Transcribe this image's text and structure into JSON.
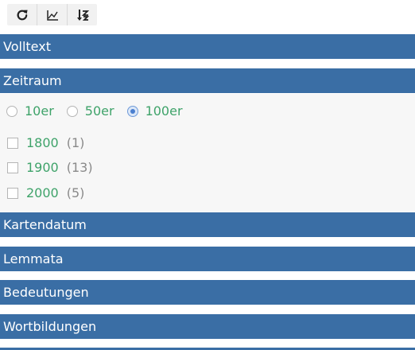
{
  "toolbar": {
    "buttons": [
      {
        "icon": "refresh-icon"
      },
      {
        "icon": "chart-icon"
      },
      {
        "icon": "sort-icon"
      }
    ]
  },
  "sections": {
    "volltext": "Volltext",
    "zeitraum": "Zeitraum",
    "kartendatum": "Kartendatum",
    "lemmata": "Lemmata",
    "bedeutungen": "Bedeutungen",
    "wortbildungen": "Wortbildungen"
  },
  "zeitraum": {
    "interval_options": [
      {
        "label": "10er",
        "checked": false
      },
      {
        "label": "50er",
        "checked": false
      },
      {
        "label": "100er",
        "checked": true
      }
    ],
    "items": [
      {
        "label": "1800",
        "count": "(1)"
      },
      {
        "label": "1900",
        "count": "(13)"
      },
      {
        "label": "2000",
        "count": "(5)"
      }
    ]
  },
  "colors": {
    "header_bar": "#3a6ea5",
    "link_green": "#3fa36a",
    "panel_bg": "#f7f7f7"
  }
}
